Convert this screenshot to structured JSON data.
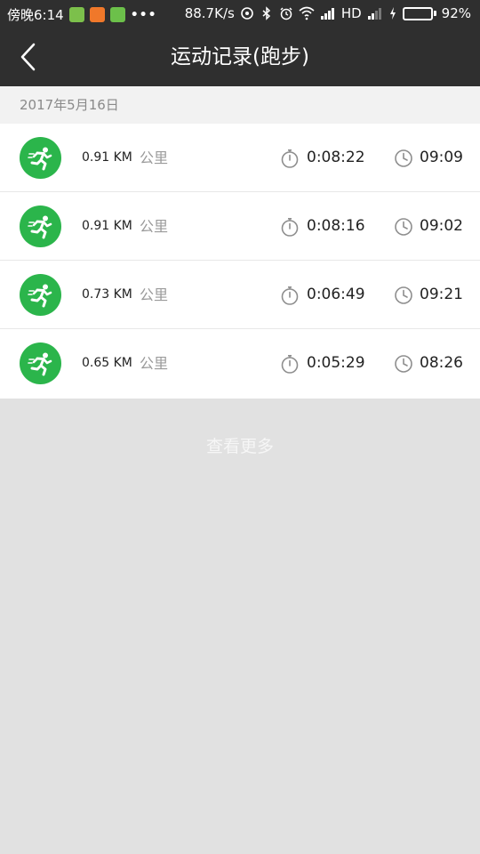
{
  "status_bar": {
    "time": "傍晚6:14",
    "net_speed": "88.7K/s",
    "hd": "HD",
    "battery": "92%",
    "battery_level": 0.92,
    "app_badge_colors": [
      "#7cc04b",
      "#f0782a",
      "#6cc04a"
    ]
  },
  "header": {
    "back_icon": "chevron-left-icon",
    "title": "运动记录(跑步)"
  },
  "date_label": "2017年5月16日",
  "colors": {
    "accent_green": "#2bb54b",
    "title_bg": "#2f2f2f"
  },
  "records": [
    {
      "distance": "0.91 KM",
      "unit": "公里",
      "duration": "0:08:22",
      "start_time": "09:09"
    },
    {
      "distance": "0.91 KM",
      "unit": "公里",
      "duration": "0:08:16",
      "start_time": "09:02"
    },
    {
      "distance": "0.73 KM",
      "unit": "公里",
      "duration": "0:06:49",
      "start_time": "09:21"
    },
    {
      "distance": "0.65 KM",
      "unit": "公里",
      "duration": "0:05:29",
      "start_time": "08:26"
    }
  ],
  "load_more": "查看更多"
}
